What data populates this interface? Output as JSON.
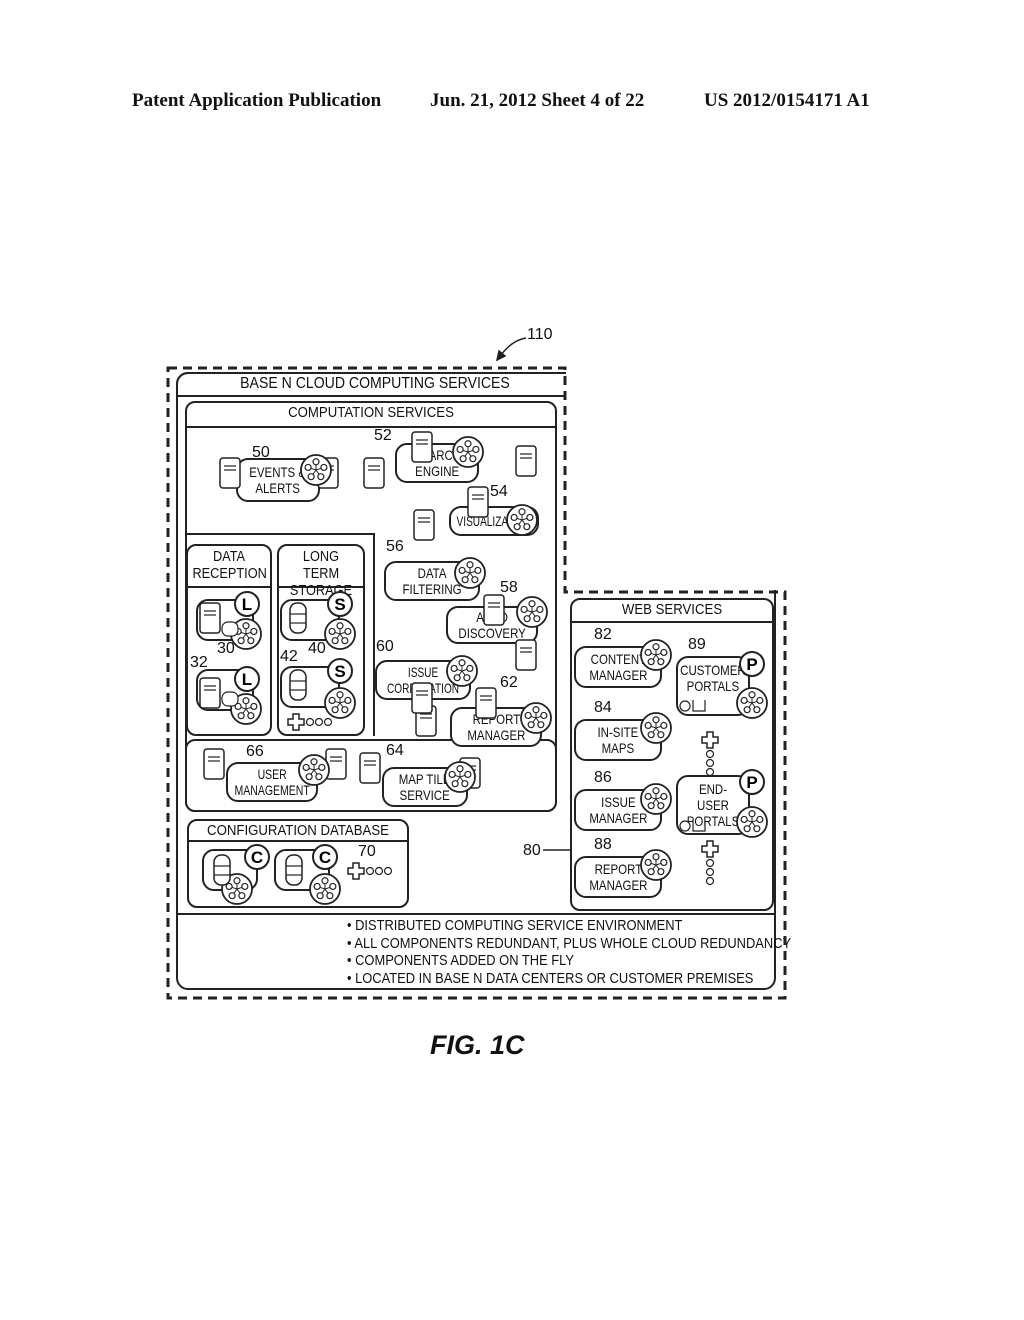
{
  "header": {
    "publication": "Patent Application Publication",
    "date_sheet": "Jun. 21, 2012   Sheet 4 of 22",
    "patent_number": "US 2012/0154171 A1"
  },
  "figure": {
    "ref_overall": "110",
    "cloud_title": "BASE N CLOUD COMPUTING SERVICES",
    "computation": {
      "title": "COMPUTATION SERVICES",
      "services": [
        {
          "ref": "50",
          "label": "EVENTS &\nALERTS"
        },
        {
          "ref": "52",
          "label": "SEARCH\nENGINE"
        },
        {
          "ref": "54",
          "label": "VISUALIZATION"
        },
        {
          "ref": "56",
          "label": "DATA\nFILTERING"
        },
        {
          "ref": "58",
          "label": "AUTO\nDISCOVERY"
        },
        {
          "ref": "60",
          "label": "ISSUE\nCORRELATION"
        },
        {
          "ref": "62",
          "label": "REPORT\nMANAGER"
        },
        {
          "ref": "66",
          "label": "USER\nMANAGEMENT"
        },
        {
          "ref": "64",
          "label": "MAP TILE\nSERVICE"
        }
      ]
    },
    "data_reception": {
      "title": "DATA\nRECEPTION",
      "refs": [
        "30",
        "32"
      ],
      "badge": "L"
    },
    "long_term_storage": {
      "title": "LONG TERM\nSTORAGE",
      "refs": [
        "40",
        "42"
      ],
      "badge": "S"
    },
    "configuration_database": {
      "title": "CONFIGURATION DATABASE",
      "ref": "70",
      "badge": "C"
    },
    "web_services": {
      "title": "WEB SERVICES",
      "ref": "80",
      "services": [
        {
          "ref": "82",
          "label": "CONTENT\nMANAGER"
        },
        {
          "ref": "84",
          "label": "IN-SITE\nMAPS"
        },
        {
          "ref": "86",
          "label": "ISSUE\nMANAGER"
        },
        {
          "ref": "88",
          "label": "REPORT\nMANAGER"
        }
      ],
      "portals": [
        {
          "ref": "89",
          "label": "CUSTOMER\nPORTALS",
          "badge": "P"
        },
        {
          "ref": "",
          "label": "END-USER\nPORTALS",
          "badge": "P"
        }
      ]
    },
    "bullets": [
      "• DISTRIBUTED COMPUTING SERVICE ENVIRONMENT",
      "• ALL COMPONENTS REDUNDANT, PLUS WHOLE CLOUD REDUNDANCY",
      "• COMPONENTS ADDED ON THE FLY",
      "• LOCATED IN BASE N DATA CENTERS OR CUSTOMER PREMISES"
    ],
    "caption": "FIG. 1C"
  }
}
